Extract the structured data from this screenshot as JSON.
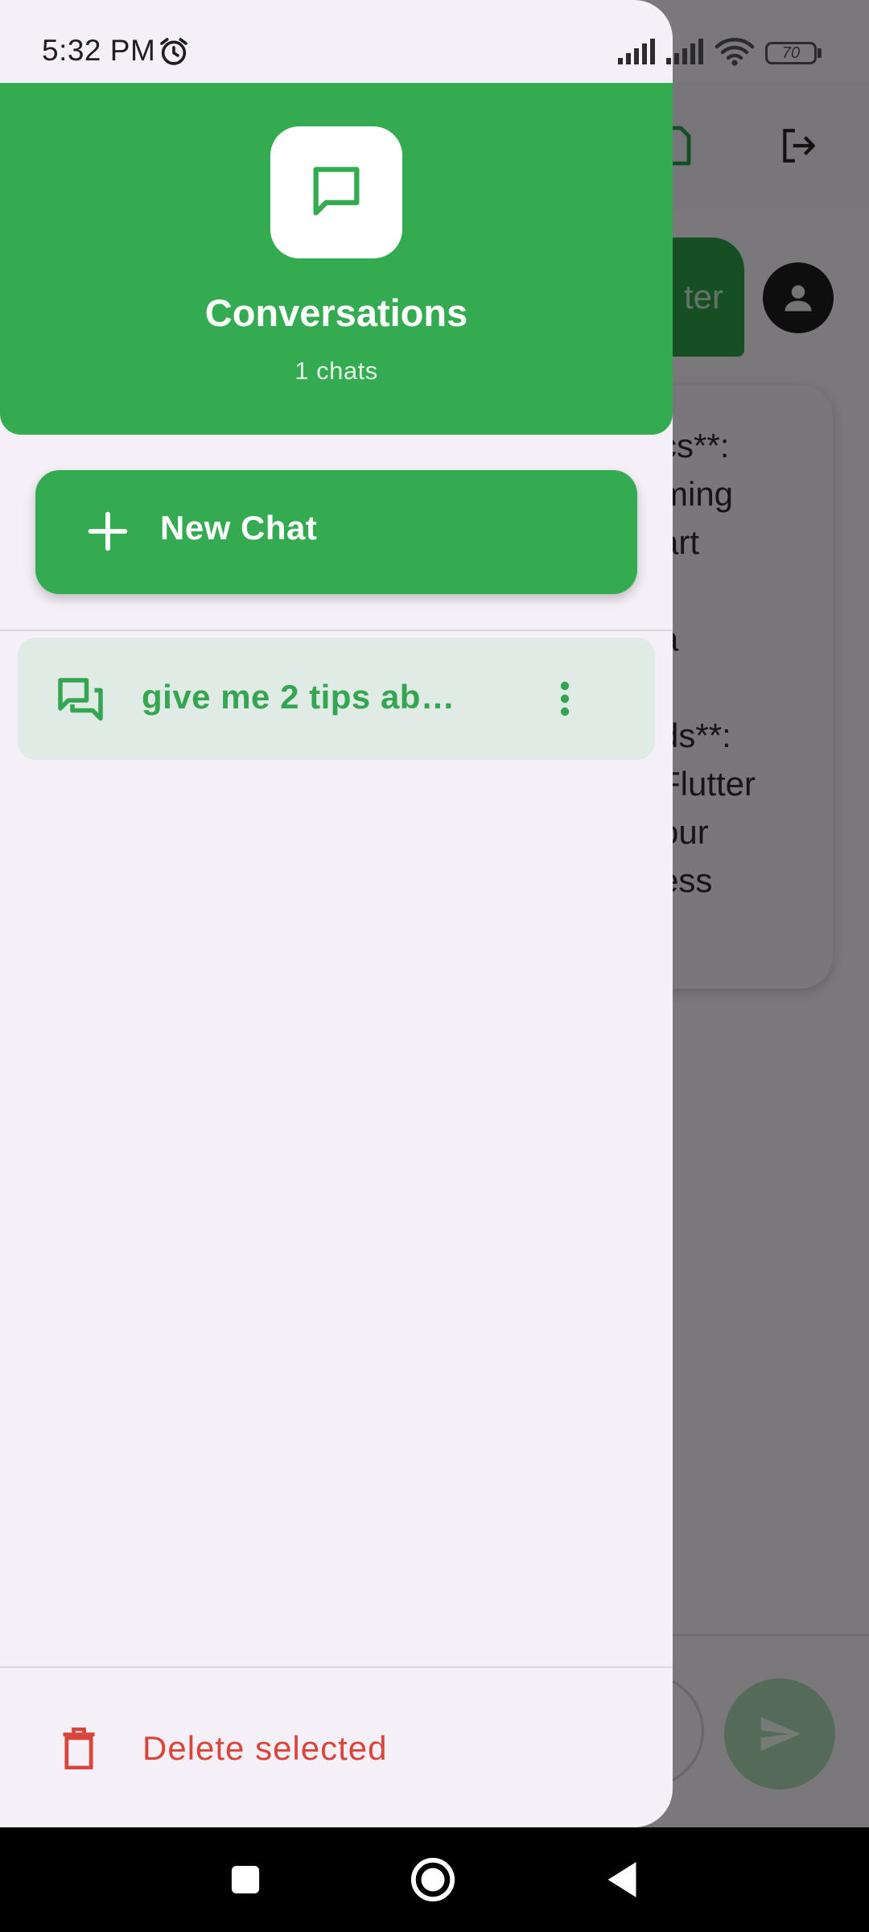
{
  "status_bar": {
    "time": "5:32 PM",
    "battery": "70"
  },
  "background": {
    "chip_text": "ter",
    "lines": [
      "cs**:",
      "ming",
      "art",
      "a",
      "ds**:",
      "Flutter",
      "our",
      "ess"
    ]
  },
  "drawer": {
    "title": "Conversations",
    "subtitle": "1 chats",
    "new_chat_label": "New Chat",
    "conversations": [
      {
        "title": "give me 2 tips ab…"
      }
    ],
    "delete_label": "Delete selected"
  },
  "colors": {
    "primary_green": "#34ab50",
    "danger_red": "#d9453b",
    "selected_item_bg": "#e1ebe6"
  }
}
